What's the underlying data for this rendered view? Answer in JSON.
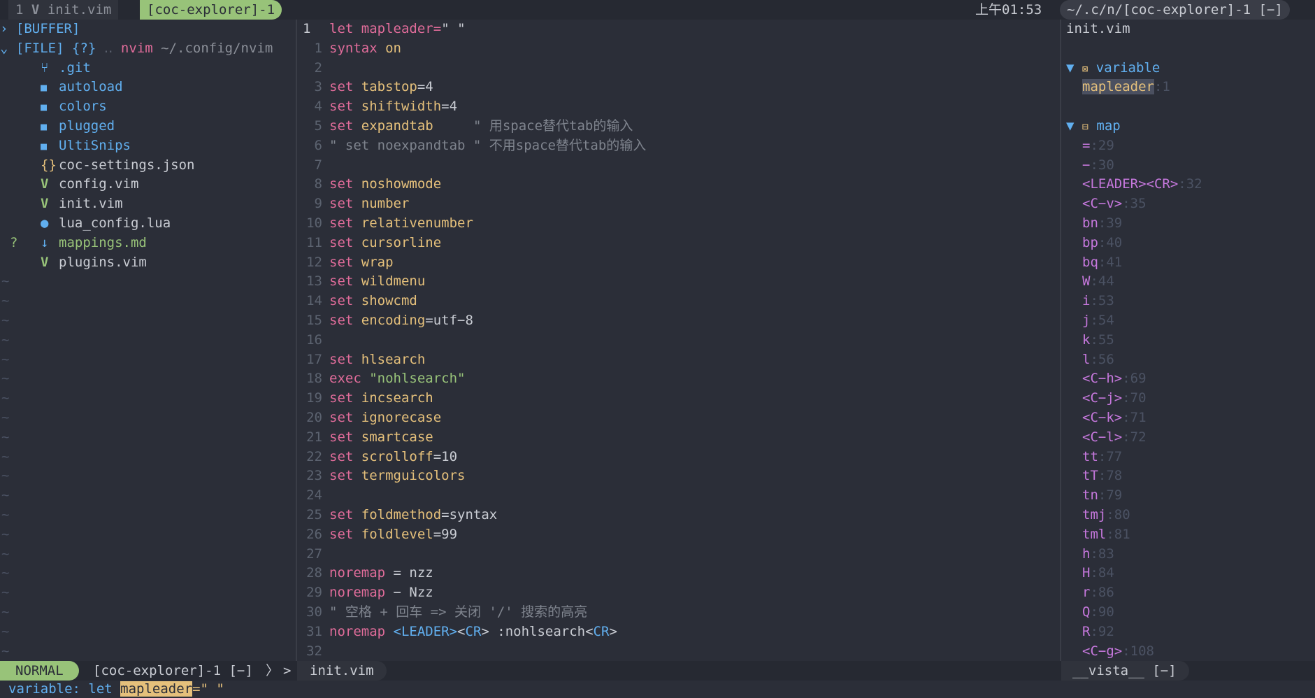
{
  "tabline": {
    "tab1_num": "1",
    "tab1_icon": "vim-icon",
    "tab1_label": "init.vim",
    "tab2_label": "[coc-explorer]-1",
    "clock": "上午01:53",
    "right_label": "~/.c/n/[coc-explorer]-1 [−]"
  },
  "explorer": {
    "buffer_label": "[BUFFER]",
    "file_label": "[FILE]",
    "file_marker": "{?}",
    "dots": "‥",
    "root_name": "nvim",
    "root_path": "~/.config/nvim",
    "items": [
      {
        "name": ".git",
        "icon": "git-branch-icon",
        "glyph": "⑂",
        "iconClass": "icon-git",
        "color": "blue",
        "status": ""
      },
      {
        "name": "autoload",
        "icon": "folder-icon",
        "glyph": "■",
        "iconClass": "icon-folder",
        "color": "blue",
        "status": ""
      },
      {
        "name": "colors",
        "icon": "folder-icon",
        "glyph": "■",
        "iconClass": "icon-folder",
        "color": "blue",
        "status": ""
      },
      {
        "name": "plugged",
        "icon": "folder-icon",
        "glyph": "■",
        "iconClass": "icon-folder",
        "color": "blue",
        "status": ""
      },
      {
        "name": "UltiSnips",
        "icon": "folder-icon",
        "glyph": "■",
        "iconClass": "icon-folder",
        "color": "blue",
        "status": ""
      },
      {
        "name": "coc-settings.json",
        "icon": "json-icon",
        "glyph": "{}",
        "iconClass": "icon-json",
        "color": "txt",
        "status": ""
      },
      {
        "name": "config.vim",
        "icon": "vim-icon",
        "glyph": "V",
        "iconClass": "icon-vim",
        "color": "txt",
        "status": ""
      },
      {
        "name": "init.vim",
        "icon": "vim-icon",
        "glyph": "V",
        "iconClass": "icon-vim",
        "color": "txt",
        "status": ""
      },
      {
        "name": "lua_config.lua",
        "icon": "lua-icon",
        "glyph": "●",
        "iconClass": "icon-lua",
        "color": "txt",
        "status": ""
      },
      {
        "name": "mappings.md",
        "icon": "markdown-icon",
        "glyph": "↓",
        "iconClass": "icon-md",
        "color": "green",
        "status": "?"
      },
      {
        "name": "plugins.vim",
        "icon": "vim-icon",
        "glyph": "V",
        "iconClass": "icon-vim",
        "color": "txt",
        "status": ""
      }
    ],
    "tilde": "~"
  },
  "editor": {
    "lines": [
      {
        "n": "1",
        "cur": true,
        "parts": [
          [
            "kw",
            "let"
          ],
          [
            "txt",
            " "
          ],
          [
            "kw",
            "mapleader"
          ],
          [
            "kw",
            "="
          ],
          [
            "txt",
            "\" \""
          ]
        ]
      },
      {
        "n": "1",
        "parts": [
          [
            "kw",
            "syntax"
          ],
          [
            "txt",
            " "
          ],
          [
            "opt",
            "on"
          ]
        ]
      },
      {
        "n": "2",
        "parts": []
      },
      {
        "n": "3",
        "parts": [
          [
            "kw",
            "set"
          ],
          [
            "txt",
            " "
          ],
          [
            "opt",
            "tabstop"
          ],
          [
            "txt",
            "=4"
          ]
        ]
      },
      {
        "n": "4",
        "parts": [
          [
            "kw",
            "set"
          ],
          [
            "txt",
            " "
          ],
          [
            "opt",
            "shiftwidth"
          ],
          [
            "txt",
            "=4"
          ]
        ]
      },
      {
        "n": "5",
        "parts": [
          [
            "kw",
            "set"
          ],
          [
            "txt",
            " "
          ],
          [
            "opt",
            "expandtab"
          ],
          [
            "txt",
            "     "
          ],
          [
            "cmt",
            "\" 用space替代tab的输入"
          ]
        ]
      },
      {
        "n": "6",
        "parts": [
          [
            "cmt",
            "\" set noexpandtab \" 不用space替代tab的输入"
          ]
        ]
      },
      {
        "n": "7",
        "parts": []
      },
      {
        "n": "8",
        "parts": [
          [
            "kw",
            "set"
          ],
          [
            "txt",
            " "
          ],
          [
            "opt",
            "noshowmode"
          ]
        ]
      },
      {
        "n": "9",
        "parts": [
          [
            "kw",
            "set"
          ],
          [
            "txt",
            " "
          ],
          [
            "opt",
            "number"
          ]
        ]
      },
      {
        "n": "10",
        "parts": [
          [
            "kw",
            "set"
          ],
          [
            "txt",
            " "
          ],
          [
            "opt",
            "relativenumber"
          ]
        ]
      },
      {
        "n": "11",
        "parts": [
          [
            "kw",
            "set"
          ],
          [
            "txt",
            " "
          ],
          [
            "opt",
            "cursorline"
          ]
        ]
      },
      {
        "n": "12",
        "parts": [
          [
            "kw",
            "set"
          ],
          [
            "txt",
            " "
          ],
          [
            "opt",
            "wrap"
          ]
        ]
      },
      {
        "n": "13",
        "parts": [
          [
            "kw",
            "set"
          ],
          [
            "txt",
            " "
          ],
          [
            "opt",
            "wildmenu"
          ]
        ]
      },
      {
        "n": "14",
        "parts": [
          [
            "kw",
            "set"
          ],
          [
            "txt",
            " "
          ],
          [
            "opt",
            "showcmd"
          ]
        ]
      },
      {
        "n": "15",
        "parts": [
          [
            "kw",
            "set"
          ],
          [
            "txt",
            " "
          ],
          [
            "opt",
            "encoding"
          ],
          [
            "txt",
            "=utf−8"
          ]
        ]
      },
      {
        "n": "16",
        "parts": []
      },
      {
        "n": "17",
        "parts": [
          [
            "kw",
            "set"
          ],
          [
            "txt",
            " "
          ],
          [
            "opt",
            "hlsearch"
          ]
        ]
      },
      {
        "n": "18",
        "parts": [
          [
            "kw",
            "exec"
          ],
          [
            "txt",
            " "
          ],
          [
            "str",
            "\"nohlsearch\""
          ]
        ]
      },
      {
        "n": "19",
        "parts": [
          [
            "kw",
            "set"
          ],
          [
            "txt",
            " "
          ],
          [
            "opt",
            "incsearch"
          ]
        ]
      },
      {
        "n": "20",
        "parts": [
          [
            "kw",
            "set"
          ],
          [
            "txt",
            " "
          ],
          [
            "opt",
            "ignorecase"
          ]
        ]
      },
      {
        "n": "21",
        "parts": [
          [
            "kw",
            "set"
          ],
          [
            "txt",
            " "
          ],
          [
            "opt",
            "smartcase"
          ]
        ]
      },
      {
        "n": "22",
        "parts": [
          [
            "kw",
            "set"
          ],
          [
            "txt",
            " "
          ],
          [
            "opt",
            "scrolloff"
          ],
          [
            "txt",
            "=10"
          ]
        ]
      },
      {
        "n": "23",
        "parts": [
          [
            "kw",
            "set"
          ],
          [
            "txt",
            " "
          ],
          [
            "opt",
            "termguicolors"
          ]
        ]
      },
      {
        "n": "24",
        "parts": []
      },
      {
        "n": "25",
        "parts": [
          [
            "kw",
            "set"
          ],
          [
            "txt",
            " "
          ],
          [
            "opt",
            "foldmethod"
          ],
          [
            "txt",
            "=syntax"
          ]
        ]
      },
      {
        "n": "26",
        "parts": [
          [
            "kw",
            "set"
          ],
          [
            "txt",
            " "
          ],
          [
            "opt",
            "foldlevel"
          ],
          [
            "txt",
            "=99"
          ]
        ]
      },
      {
        "n": "27",
        "parts": []
      },
      {
        "n": "28",
        "parts": [
          [
            "kw",
            "noremap"
          ],
          [
            "txt",
            " = nzz"
          ]
        ]
      },
      {
        "n": "29",
        "parts": [
          [
            "kw",
            "noremap"
          ],
          [
            "txt",
            " − Nzz"
          ]
        ]
      },
      {
        "n": "30",
        "parts": [
          [
            "cmt",
            "\" 空格 + 回车 => 关闭 '/' 搜索的高亮"
          ]
        ]
      },
      {
        "n": "31",
        "parts": [
          [
            "kw",
            "noremap"
          ],
          [
            "txt",
            " "
          ],
          [
            "key",
            "<LEADER>"
          ],
          [
            "txt",
            "<"
          ],
          [
            "key",
            "CR"
          ],
          [
            "txt",
            "> :nohlsearch<"
          ],
          [
            "key",
            "CR"
          ],
          [
            "txt",
            ">"
          ]
        ]
      },
      {
        "n": "32",
        "parts": []
      }
    ]
  },
  "vista": {
    "file": "init.vim",
    "variable_label": "variable",
    "variable_items": [
      {
        "name": "mapleader",
        "line": "1"
      }
    ],
    "map_label": "map",
    "map_items": [
      {
        "name": "=",
        "line": "29"
      },
      {
        "name": "−",
        "line": "30"
      },
      {
        "name": "<LEADER><CR>",
        "line": "32"
      },
      {
        "name": "<C−v>",
        "line": "35"
      },
      {
        "name": "bn",
        "line": "39"
      },
      {
        "name": "bp",
        "line": "40"
      },
      {
        "name": "bq",
        "line": "41"
      },
      {
        "name": "W",
        "line": "44"
      },
      {
        "name": "i",
        "line": "53"
      },
      {
        "name": "j",
        "line": "54"
      },
      {
        "name": "k",
        "line": "55"
      },
      {
        "name": "l",
        "line": "56"
      },
      {
        "name": "<C−h>",
        "line": "69"
      },
      {
        "name": "<C−j>",
        "line": "70"
      },
      {
        "name": "<C−k>",
        "line": "71"
      },
      {
        "name": "<C−l>",
        "line": "72"
      },
      {
        "name": "tt",
        "line": "77"
      },
      {
        "name": "tT",
        "line": "78"
      },
      {
        "name": "tn",
        "line": "79"
      },
      {
        "name": "tmj",
        "line": "80"
      },
      {
        "name": "tml",
        "line": "81"
      },
      {
        "name": "h",
        "line": "83"
      },
      {
        "name": "H",
        "line": "84"
      },
      {
        "name": "r",
        "line": "86"
      },
      {
        "name": "Q",
        "line": "90"
      },
      {
        "name": "R",
        "line": "92"
      },
      {
        "name": "<C−g>",
        "line": "108"
      }
    ]
  },
  "statusline": {
    "mode": "NORMAL",
    "left_file": "[coc-explorer]-1 [−]",
    "arrow": ">",
    "mid_file": "init.vim",
    "right_file": "__vista__ [−]"
  },
  "cmdline": {
    "prefix": "variable: let ",
    "highlight": "mapleader",
    "suffix": "=\" \""
  }
}
